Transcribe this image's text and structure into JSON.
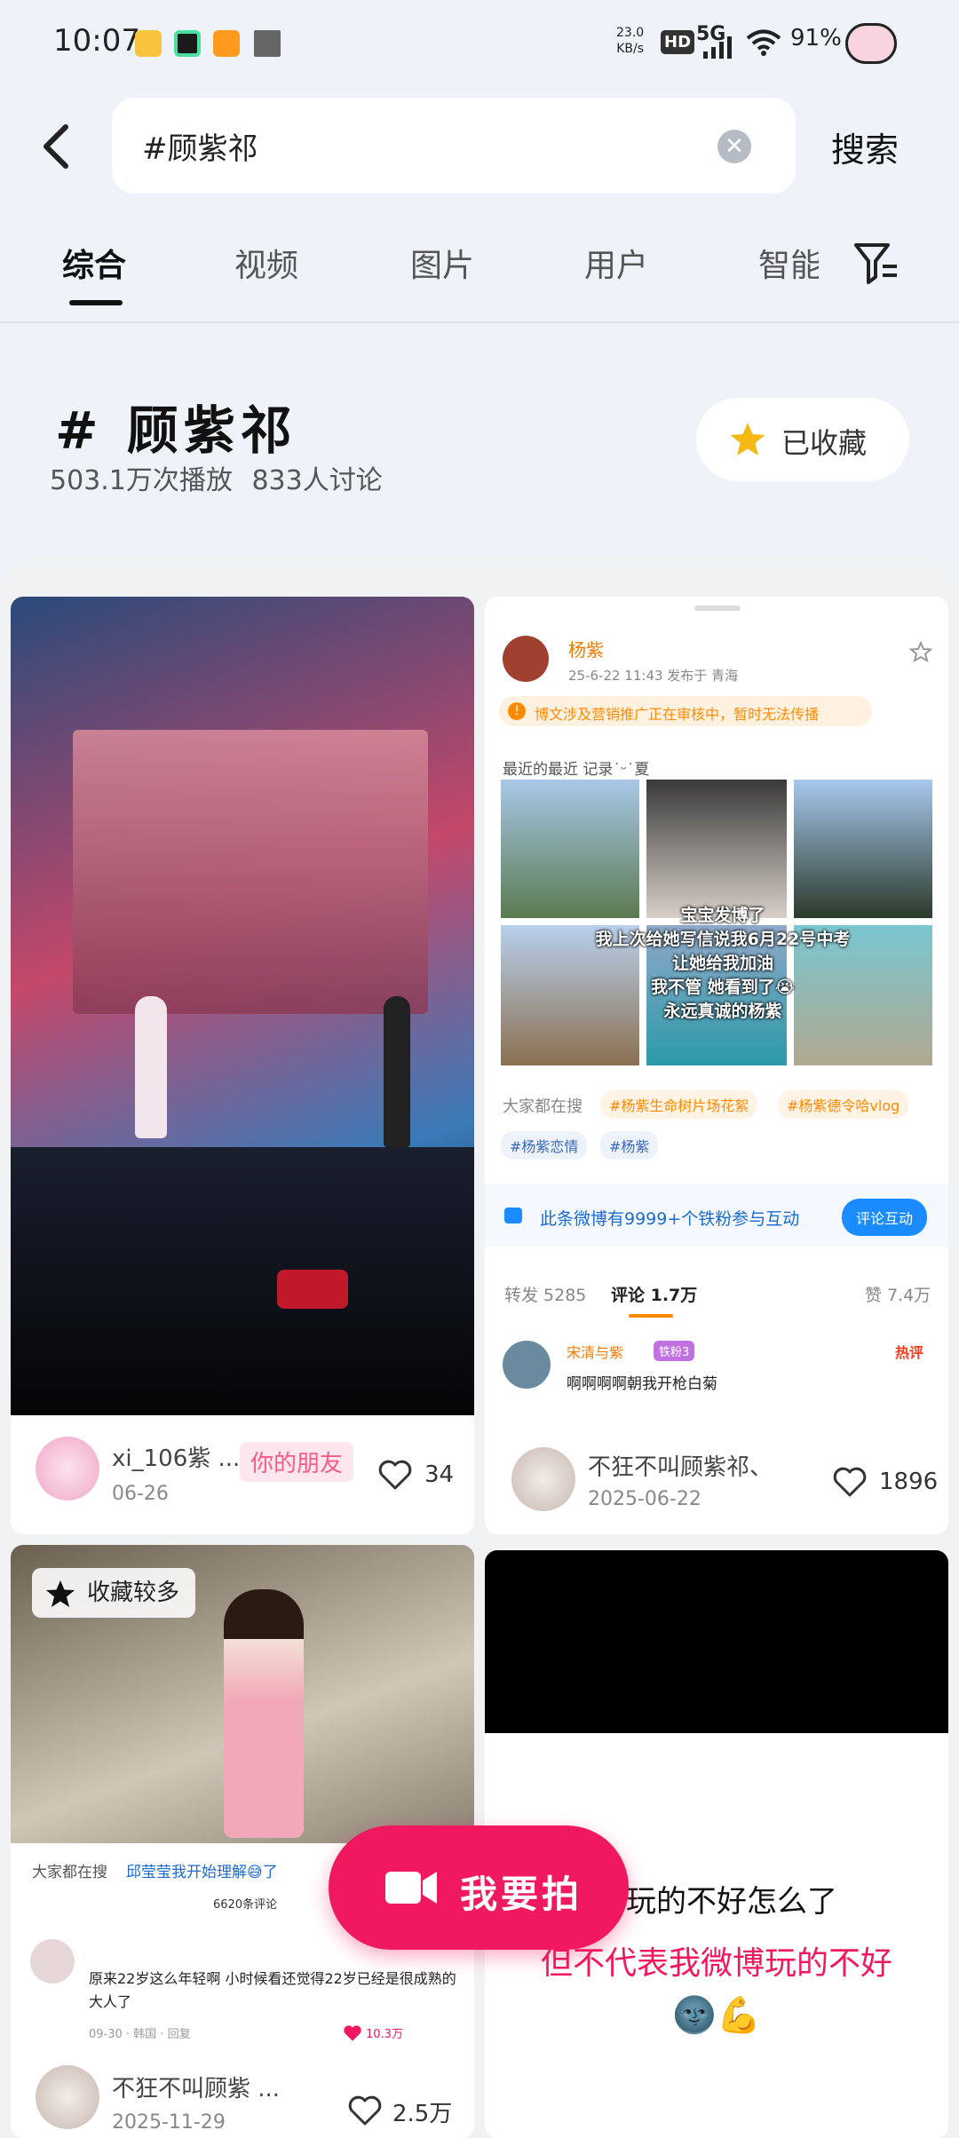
{
  "status_bar": {
    "time": "10:07",
    "net_speed": "23.0\nKB/s",
    "net_speed_value": "23.0",
    "net_speed_unit": "KB/s",
    "hd": "HD",
    "signal": "5G",
    "battery": "91%"
  },
  "search": {
    "query": "#顾紫祁",
    "button": "搜索"
  },
  "tabs": [
    "综合",
    "视频",
    "图片",
    "用户",
    "智能"
  ],
  "topic": {
    "title": "# 顾紫祁",
    "plays": "503.1万次播放",
    "discussions": "833人讨论",
    "fav_label": "已收藏"
  },
  "cards": {
    "card1": {
      "user": "xi_106紫 ...",
      "date": "06-26",
      "badge": "你的朋友",
      "likes": "34"
    },
    "card2": {
      "poster": "杨紫",
      "post_meta": "25-6-22 11:43  发布于 青海",
      "notice": "博文涉及营销推广正在审核中，暂时无法传播",
      "post_text": "最近的最近 记录˙ᵕ˙夏",
      "overlay_lines": [
        "宝宝发博了",
        "我上次给她写信说我6月22号中考",
        "让她给我加油",
        "我不管 她看到了😭",
        "永远真诚的杨紫"
      ],
      "search_label": "大家都在搜",
      "tags": [
        "#杨紫生命树片场花絮",
        "#杨紫德令哈vlog",
        "#杨紫恋情",
        "#杨紫"
      ],
      "interaction_text": "此条微博有9999+个铁粉参与互动",
      "interaction_btn": "评论互动",
      "reposts": "转发 5285",
      "comments": "评论 1.7万",
      "likes_count": "赞 7.4万",
      "commenter": "宋清与紫",
      "commenter_badge": "铁粉3",
      "hot_label": "热评",
      "comment": "啊啊啊啊朝我开枪白菊",
      "user": "不狂不叫顾紫祁、",
      "date": "2025-06-22",
      "likes": "1896"
    },
    "card3": {
      "badge": "收藏较多",
      "search_label": "大家都在搜",
      "search_term": "邱莹莹我开始理解😅了",
      "comment_count": "6620条评论",
      "comment": "原来22岁这么年轻啊 小时候看还觉得22岁已经是很成熟的大人了",
      "comment_meta": "09-30 · 韩国 · 回复",
      "comment_likes": "10.3万",
      "user": "不狂不叫顾紫 ...",
      "date": "2025-11-29",
      "likes": "2.5万"
    },
    "card4": {
      "line1": "手玩的不好怎么了",
      "line2": "但不代表我微博玩的不好",
      "emoji": "🌚💪"
    }
  },
  "fab": {
    "label": "我要拍"
  },
  "colors": {
    "accent": "#f0185f",
    "blue": "#1a8cff",
    "orange": "#ff8a00",
    "pink_badge": "#f25c86"
  }
}
